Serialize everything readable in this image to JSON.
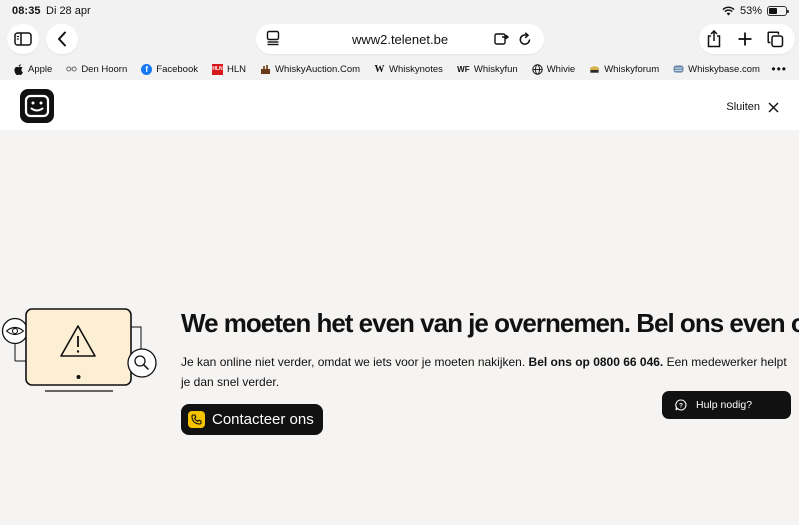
{
  "status_bar": {
    "time": "08:35",
    "date": "Di 28 apr",
    "battery": "53%",
    "battery_level": 0.53
  },
  "toolbar": {
    "url": "www2.telenet.be"
  },
  "bookmarks": [
    {
      "label": "Apple",
      "icon": "apple-icon"
    },
    {
      "label": "Den Hoorn",
      "icon": "glasses-icon"
    },
    {
      "label": "Facebook",
      "icon": "facebook-icon"
    },
    {
      "label": "HLN",
      "icon": "hln-icon"
    },
    {
      "label": "WhiskyAuction.Com",
      "icon": "whiskyauction-icon"
    },
    {
      "label": "Whiskynotes",
      "icon": "whiskynotes-icon"
    },
    {
      "label": "Whiskyfun",
      "icon": "whiskyfun-icon"
    },
    {
      "label": "Whivie",
      "icon": "globe-icon"
    },
    {
      "label": "Whiskyforum",
      "icon": "whiskyforum-icon"
    },
    {
      "label": "Whiskybase.com",
      "icon": "whiskybase-icon"
    }
  ],
  "site": {
    "close_label": "Sluiten",
    "brand_color": "#f5c400"
  },
  "main": {
    "headline": "We moeten het even van je overnemen. Bel ons even op.",
    "text_before": "Je kan online niet verder, omdat we iets voor je moeten nakijken. ",
    "text_bold": "Bel ons op 0800 66 046.",
    "text_after": " Een medewerker helpt je dan snel verder.",
    "cta_label": "Contacteer ons"
  },
  "help": {
    "label": "Hulp nodig?"
  }
}
